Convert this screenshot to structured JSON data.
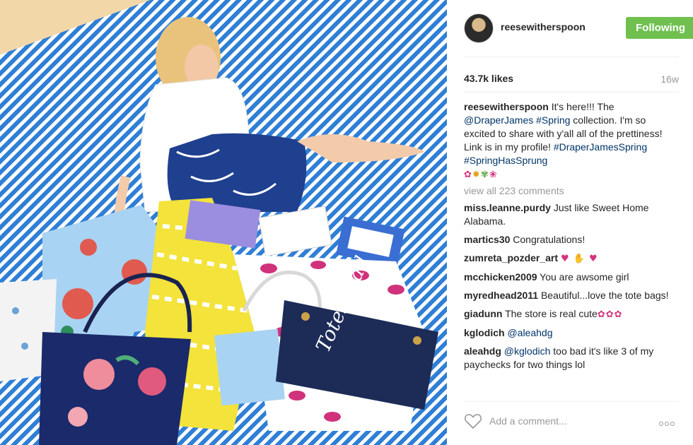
{
  "post": {
    "username": "reesewitherspoon",
    "follow_label": "Following",
    "likes": "43.7k likes",
    "age": "16w",
    "caption": {
      "user": "reesewitherspoon",
      "t1": " It's here!!! The ",
      "tag1": "@DraperJames",
      "t2": " ",
      "tag2": "#Spring",
      "t3": " collection. I'm so excited to share with y'all all of the prettiness! Link is in my profile! ",
      "tag3": "#DraperJamesSpring",
      "t4": " ",
      "tag4": "#SpringHasSprung",
      "emoji_pink": "✿",
      "emoji_gold": "✹",
      "emoji_green": "✾",
      "emoji_pink2": "❀"
    },
    "view_all": "view all 223 comments",
    "comments": [
      {
        "user": "miss.leanne.purdy",
        "text": " Just like Sweet Home Alabama."
      },
      {
        "user": "martics30",
        "text": " Congratulations!"
      },
      {
        "user": "zumreta_pozder_art",
        "text": " ",
        "emoji": "♥ ✋ ♥"
      },
      {
        "user": "mcchicken2009",
        "text": " You are awsome girl"
      },
      {
        "user": "myredhead2011",
        "text": " Beautiful...love the tote bags!"
      },
      {
        "user": "giadunn",
        "text": " The store is real cute",
        "emoji": "✿✿✿"
      },
      {
        "user": "kglodich",
        "text": " ",
        "tag": "@aleahdg"
      },
      {
        "user": "aleahdg",
        "text": " too bad it's like 3 of my paychecks for two things lol",
        "tag": "@kglodich"
      }
    ],
    "add_comment_placeholder": "Add a comment...",
    "tote_text": "Totes Y'all"
  },
  "colors": {
    "follow_button": "#70c050",
    "hashtag": "#003569",
    "muted": "#999999",
    "stripe_blue": "#2f7fd6"
  },
  "icons": {
    "like": "heart-outline-icon",
    "more": "more-options-icon"
  }
}
